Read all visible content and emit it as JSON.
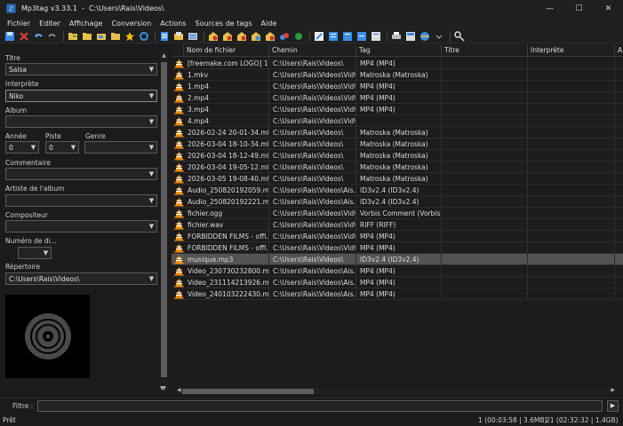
{
  "window": {
    "title": "Mp3tag v3.33.1  -  C:\\Users\\Rais\\Videos\\",
    "minimize": "—",
    "maximize": "☐",
    "close": "✕"
  },
  "menu": [
    "Fichier",
    "Editer",
    "Affichage",
    "Conversion",
    "Actions",
    "Sources de tags",
    "Aide"
  ],
  "toolbar_icons": [
    "save-icon",
    "remove-tag-icon",
    "undo-icon",
    "redo-icon",
    "add-folder-icon",
    "change-dir-icon",
    "open-folder-icon",
    "subfolder-icon",
    "favorite-star-icon",
    "refresh-icon",
    "list-icon",
    "playlist-icon",
    "image-icon",
    "tag-to-filename-icon",
    "filename-to-tag-icon",
    "tag-to-tag-icon",
    "text-to-tag-icon",
    "export-icon",
    "actions-icon",
    "edit-icon",
    "case-icon",
    "options-icon",
    "playlist2-icon",
    "playlist3-icon",
    "print-icon",
    "web-sources-icon",
    "discogs-icon",
    "config-icon"
  ],
  "left": {
    "titre_label": "Titre",
    "titre_value": "Salsa",
    "interprete_label": "Interprète",
    "interprete_value": "Niko",
    "album_label": "Album",
    "album_value": "",
    "annee_label": "Année",
    "annee_value": "0",
    "piste_label": "Piste",
    "piste_value": "0",
    "genre_label": "Genre",
    "genre_value": "",
    "commentaire_label": "Commentaire",
    "commentaire_value": "",
    "artiste_album_label": "Artiste de l'album",
    "artiste_album_value": "",
    "compositeur_label": "Compositeur",
    "compositeur_value": "",
    "numero_disque_label": "Numéro de di...",
    "numero_disque_value": "",
    "repertoire_label": "Répertoire",
    "repertoire_value": "C:\\Users\\Rais\\Videos\\"
  },
  "grid": {
    "columns": [
      "Nom de fichier",
      "Chemin",
      "Tag",
      "Titre",
      "Interprète",
      "A"
    ],
    "rows": [
      {
        "icon": "vlc-icon",
        "name": "[freemake.com LOGO] 1...",
        "path": "C:\\Users\\Rais\\Videos\\",
        "tag": "MP4 (MP4)",
        "selected": false
      },
      {
        "icon": "vlc-icon",
        "name": "1.mkv",
        "path": "C:\\Users\\Rais\\Videos\\Vid\\",
        "tag": "Matroska (Matroska)",
        "selected": false
      },
      {
        "icon": "vlc-icon",
        "name": "1.mp4",
        "path": "C:\\Users\\Rais\\Videos\\Vid\\",
        "tag": "MP4 (MP4)",
        "selected": false
      },
      {
        "icon": "vlc-icon",
        "name": "2.mp4",
        "path": "C:\\Users\\Rais\\Videos\\Vid\\",
        "tag": "MP4 (MP4)",
        "selected": false
      },
      {
        "icon": "vlc-icon",
        "name": "3.mp4",
        "path": "C:\\Users\\Rais\\Videos\\Vid\\",
        "tag": "MP4 (MP4)",
        "selected": false
      },
      {
        "icon": "vlc-icon",
        "name": "4.mp4",
        "path": "C:\\Users\\Rais\\Videos\\Vid\\",
        "tag": "",
        "selected": false
      },
      {
        "icon": "vlc-icon",
        "name": "2026-02-24 20-01-34.mkv",
        "path": "C:\\Users\\Rais\\Videos\\",
        "tag": "Matroska (Matroska)",
        "selected": false
      },
      {
        "icon": "vlc-icon",
        "name": "2026-03-04 18-10-34.mkv",
        "path": "C:\\Users\\Rais\\Videos\\",
        "tag": "Matroska (Matroska)",
        "selected": false
      },
      {
        "icon": "vlc-icon",
        "name": "2026-03-04 18-12-49.mkv",
        "path": "C:\\Users\\Rais\\Videos\\",
        "tag": "Matroska (Matroska)",
        "selected": false
      },
      {
        "icon": "vlc-icon",
        "name": "2026-03-04 19-05-12.mkv",
        "path": "C:\\Users\\Rais\\Videos\\",
        "tag": "Matroska (Matroska)",
        "selected": false
      },
      {
        "icon": "vlc-icon",
        "name": "2026-03-05 19-08-40.mkv",
        "path": "C:\\Users\\Rais\\Videos\\",
        "tag": "Matroska (Matroska)",
        "selected": false
      },
      {
        "icon": "vlc-icon",
        "name": "Audio_250820192059.m...",
        "path": "C:\\Users\\Rais\\Videos\\Ais...",
        "tag": "ID3v2.4 (ID3v2.4)",
        "selected": false
      },
      {
        "icon": "vlc-icon",
        "name": "Audio_250820192221.m...",
        "path": "C:\\Users\\Rais\\Videos\\Ais...",
        "tag": "ID3v2.4 (ID3v2.4)",
        "selected": false
      },
      {
        "icon": "vlc-icon",
        "name": "fichier.ogg",
        "path": "C:\\Users\\Rais\\Videos\\Vid\\",
        "tag": "Vorbis Comment (Vorbis ...",
        "selected": false
      },
      {
        "icon": "vlc-icon",
        "name": "fichier.wav",
        "path": "C:\\Users\\Rais\\Videos\\Vid\\",
        "tag": "RIFF (RIFF)",
        "selected": false
      },
      {
        "icon": "vlc-icon",
        "name": "FORBIDDEN FILMS - offi...",
        "path": "C:\\Users\\Rais\\Videos\\Vid\\",
        "tag": "MP4 (MP4)",
        "selected": false
      },
      {
        "icon": "vlc-icon",
        "name": "FORBIDDEN FILMS - offi...",
        "path": "C:\\Users\\Rais\\Videos\\Vid\\",
        "tag": "MP4 (MP4)",
        "selected": false
      },
      {
        "icon": "vlc-icon",
        "name": "musique.mp3",
        "path": "C:\\Users\\Rais\\Videos\\",
        "tag": "ID3v2.4 (ID3v2.4)",
        "selected": true
      },
      {
        "icon": "vlc-icon",
        "name": "Video_230730232800.mp4",
        "path": "C:\\Users\\Rais\\Videos\\Ais...",
        "tag": "MP4 (MP4)",
        "selected": false
      },
      {
        "icon": "vlc-icon",
        "name": "Video_231114213926.mp4",
        "path": "C:\\Users\\Rais\\Videos\\Ais...",
        "tag": "MP4 (MP4)",
        "selected": false
      },
      {
        "icon": "vlc-icon",
        "name": "Video_240103222430.mp4",
        "path": "C:\\Users\\Rais\\Videos\\Ais...",
        "tag": "MP4 (MP4)",
        "selected": false
      }
    ]
  },
  "filter": {
    "label": "Filtre :",
    "value": "",
    "button": "▶"
  },
  "status": {
    "left": "Prêt",
    "selection": "1 (00:03:58 | 3.6MB)",
    "total": "21 (02:32:32 | 1.4GB)"
  },
  "colors": {
    "vlc_orange": "#f08a00",
    "accent_blue": "#3a8ee6",
    "folder_yellow": "#e7c04a"
  }
}
